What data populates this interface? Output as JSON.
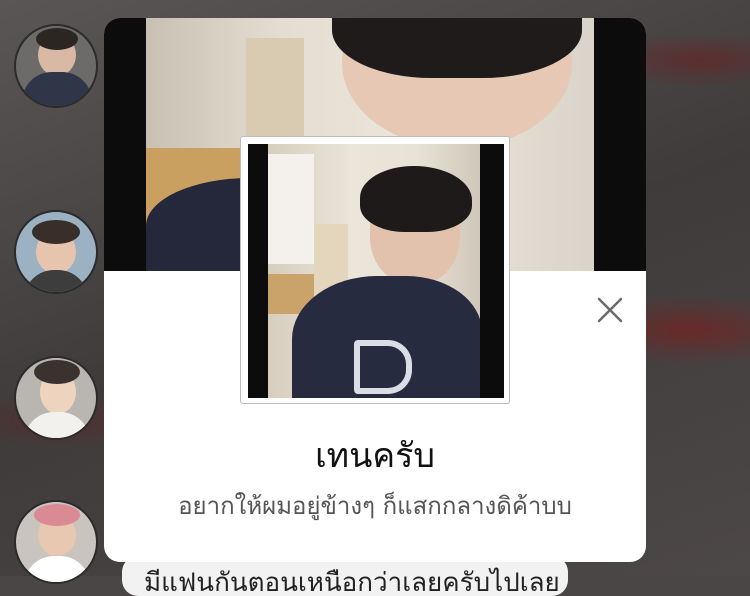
{
  "profile": {
    "name": "เทนครับ",
    "status_message": "อยากให้ผมอยู่ข้างๆ ก็แสกกลางดิค้าบบ"
  },
  "chat": {
    "partial_message": "มีแฟนกันตอนเหนือกว่าเลยครับไปเลย"
  },
  "icons": {
    "close": "close-icon"
  },
  "colors": {
    "card_background": "#ffffff",
    "overlay": "#4a4646",
    "close_icon": "#6b6b6b"
  }
}
